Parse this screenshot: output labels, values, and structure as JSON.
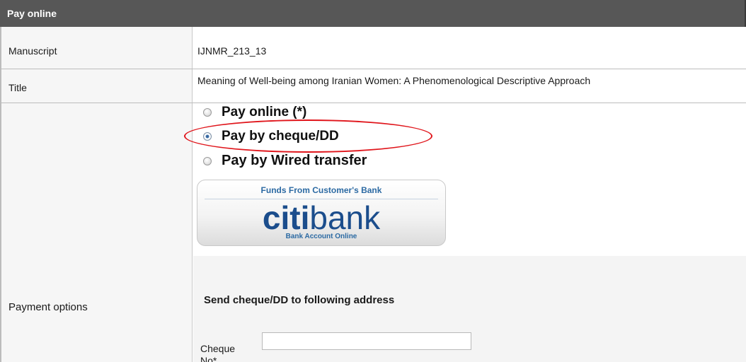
{
  "header": {
    "title": "Pay online"
  },
  "rows": {
    "manuscript": {
      "label": "Manuscript",
      "value": "IJNMR_213_13"
    },
    "title": {
      "label": "Title",
      "value": "Meaning of Well-being among Iranian Women: A Phenomenological Descriptive Approach"
    },
    "payment": {
      "label": "Payment options"
    }
  },
  "payment_options": [
    {
      "label": "Pay online (*)",
      "selected": false
    },
    {
      "label": "Pay by cheque/DD",
      "selected": true
    },
    {
      "label": "Pay by Wired transfer",
      "selected": false
    }
  ],
  "bank_logo": {
    "top_text": "Funds From Customer's Bank",
    "brand_bold": "citi",
    "brand_light": "bank",
    "sub_text": "Bank Account Online"
  },
  "cheque_section": {
    "heading": "Send cheque/DD to following address",
    "cheque_no_label": "Cheque No*",
    "cheque_no_value": ""
  },
  "colors": {
    "header_bg": "#575757",
    "highlight": "#e0151b",
    "brand": "#1b4d8c"
  }
}
